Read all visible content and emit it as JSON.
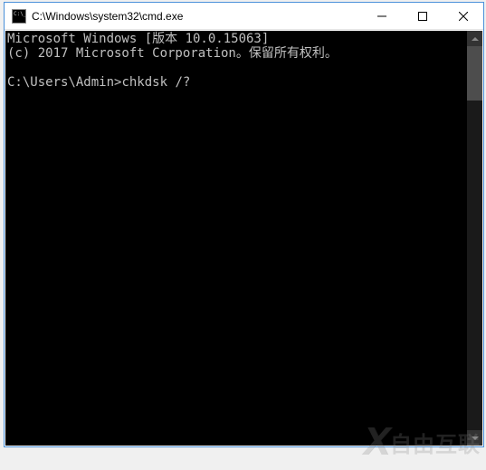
{
  "window": {
    "title": "C:\\Windows\\system32\\cmd.exe"
  },
  "console": {
    "line1": "Microsoft Windows [版本 10.0.15063]",
    "line2": "(c) 2017 Microsoft Corporation。保留所有权利。",
    "blank": "",
    "prompt": "C:\\Users\\Admin>",
    "command": "chkdsk /?"
  },
  "watermark": {
    "logo": "X",
    "text": "自由互联"
  }
}
